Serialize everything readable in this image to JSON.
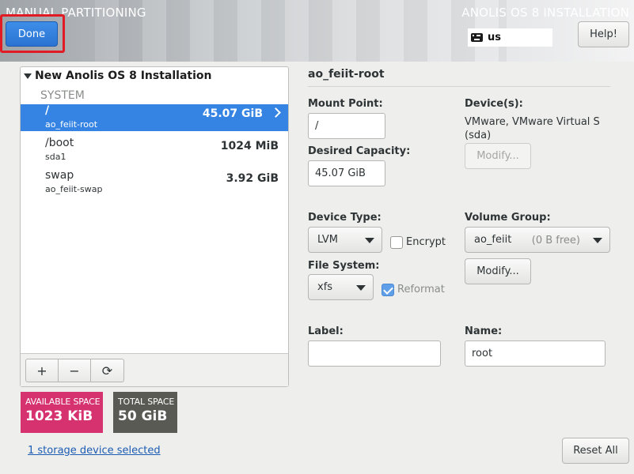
{
  "header": {
    "section_title": "MANUAL PARTITIONING",
    "product_title": "ANOLIS OS 8 INSTALLATION",
    "done_label": "Done",
    "keyboard_layout": "us",
    "help_label": "Help!"
  },
  "tree": {
    "title": "New Anolis OS 8 Installation",
    "group": "SYSTEM",
    "items": [
      {
        "mount": "/",
        "device": "ao_feiit-root",
        "size": "45.07 GiB",
        "selected": true
      },
      {
        "mount": "/boot",
        "device": "sda1",
        "size": "1024 MiB",
        "selected": false
      },
      {
        "mount": "swap",
        "device": "ao_feiit-swap",
        "size": "3.92 GiB",
        "selected": false
      }
    ],
    "toolbar": {
      "add": "+",
      "remove": "−",
      "refresh": "⟳"
    }
  },
  "space": {
    "available_label": "AVAILABLE SPACE",
    "available_value": "1023 KiB",
    "total_label": "TOTAL SPACE",
    "total_value": "50 GiB"
  },
  "storage_link": "1 storage device selected",
  "details": {
    "title": "ao_feiit-root",
    "mount_point_label": "Mount Point:",
    "mount_point_value": "/",
    "desired_capacity_label": "Desired Capacity:",
    "desired_capacity_value": "45.07 GiB",
    "devices_label": "Device(s):",
    "devices_line1": "VMware, VMware Virtual S",
    "devices_line2": "(sda)",
    "modify_devices_label": "Modify...",
    "device_type_label": "Device Type:",
    "device_type_value": "LVM",
    "encrypt_label": "Encrypt",
    "encrypt_checked": false,
    "volume_group_label": "Volume Group:",
    "volume_group_value": "ao_feiit",
    "volume_group_free": "(0 B free)",
    "modify_vg_label": "Modify...",
    "file_system_label": "File System:",
    "file_system_value": "xfs",
    "reformat_label": "Reformat",
    "reformat_checked": true,
    "label_label": "Label:",
    "label_value": "",
    "name_label": "Name:",
    "name_value": "root",
    "reset_label": "Reset All"
  }
}
